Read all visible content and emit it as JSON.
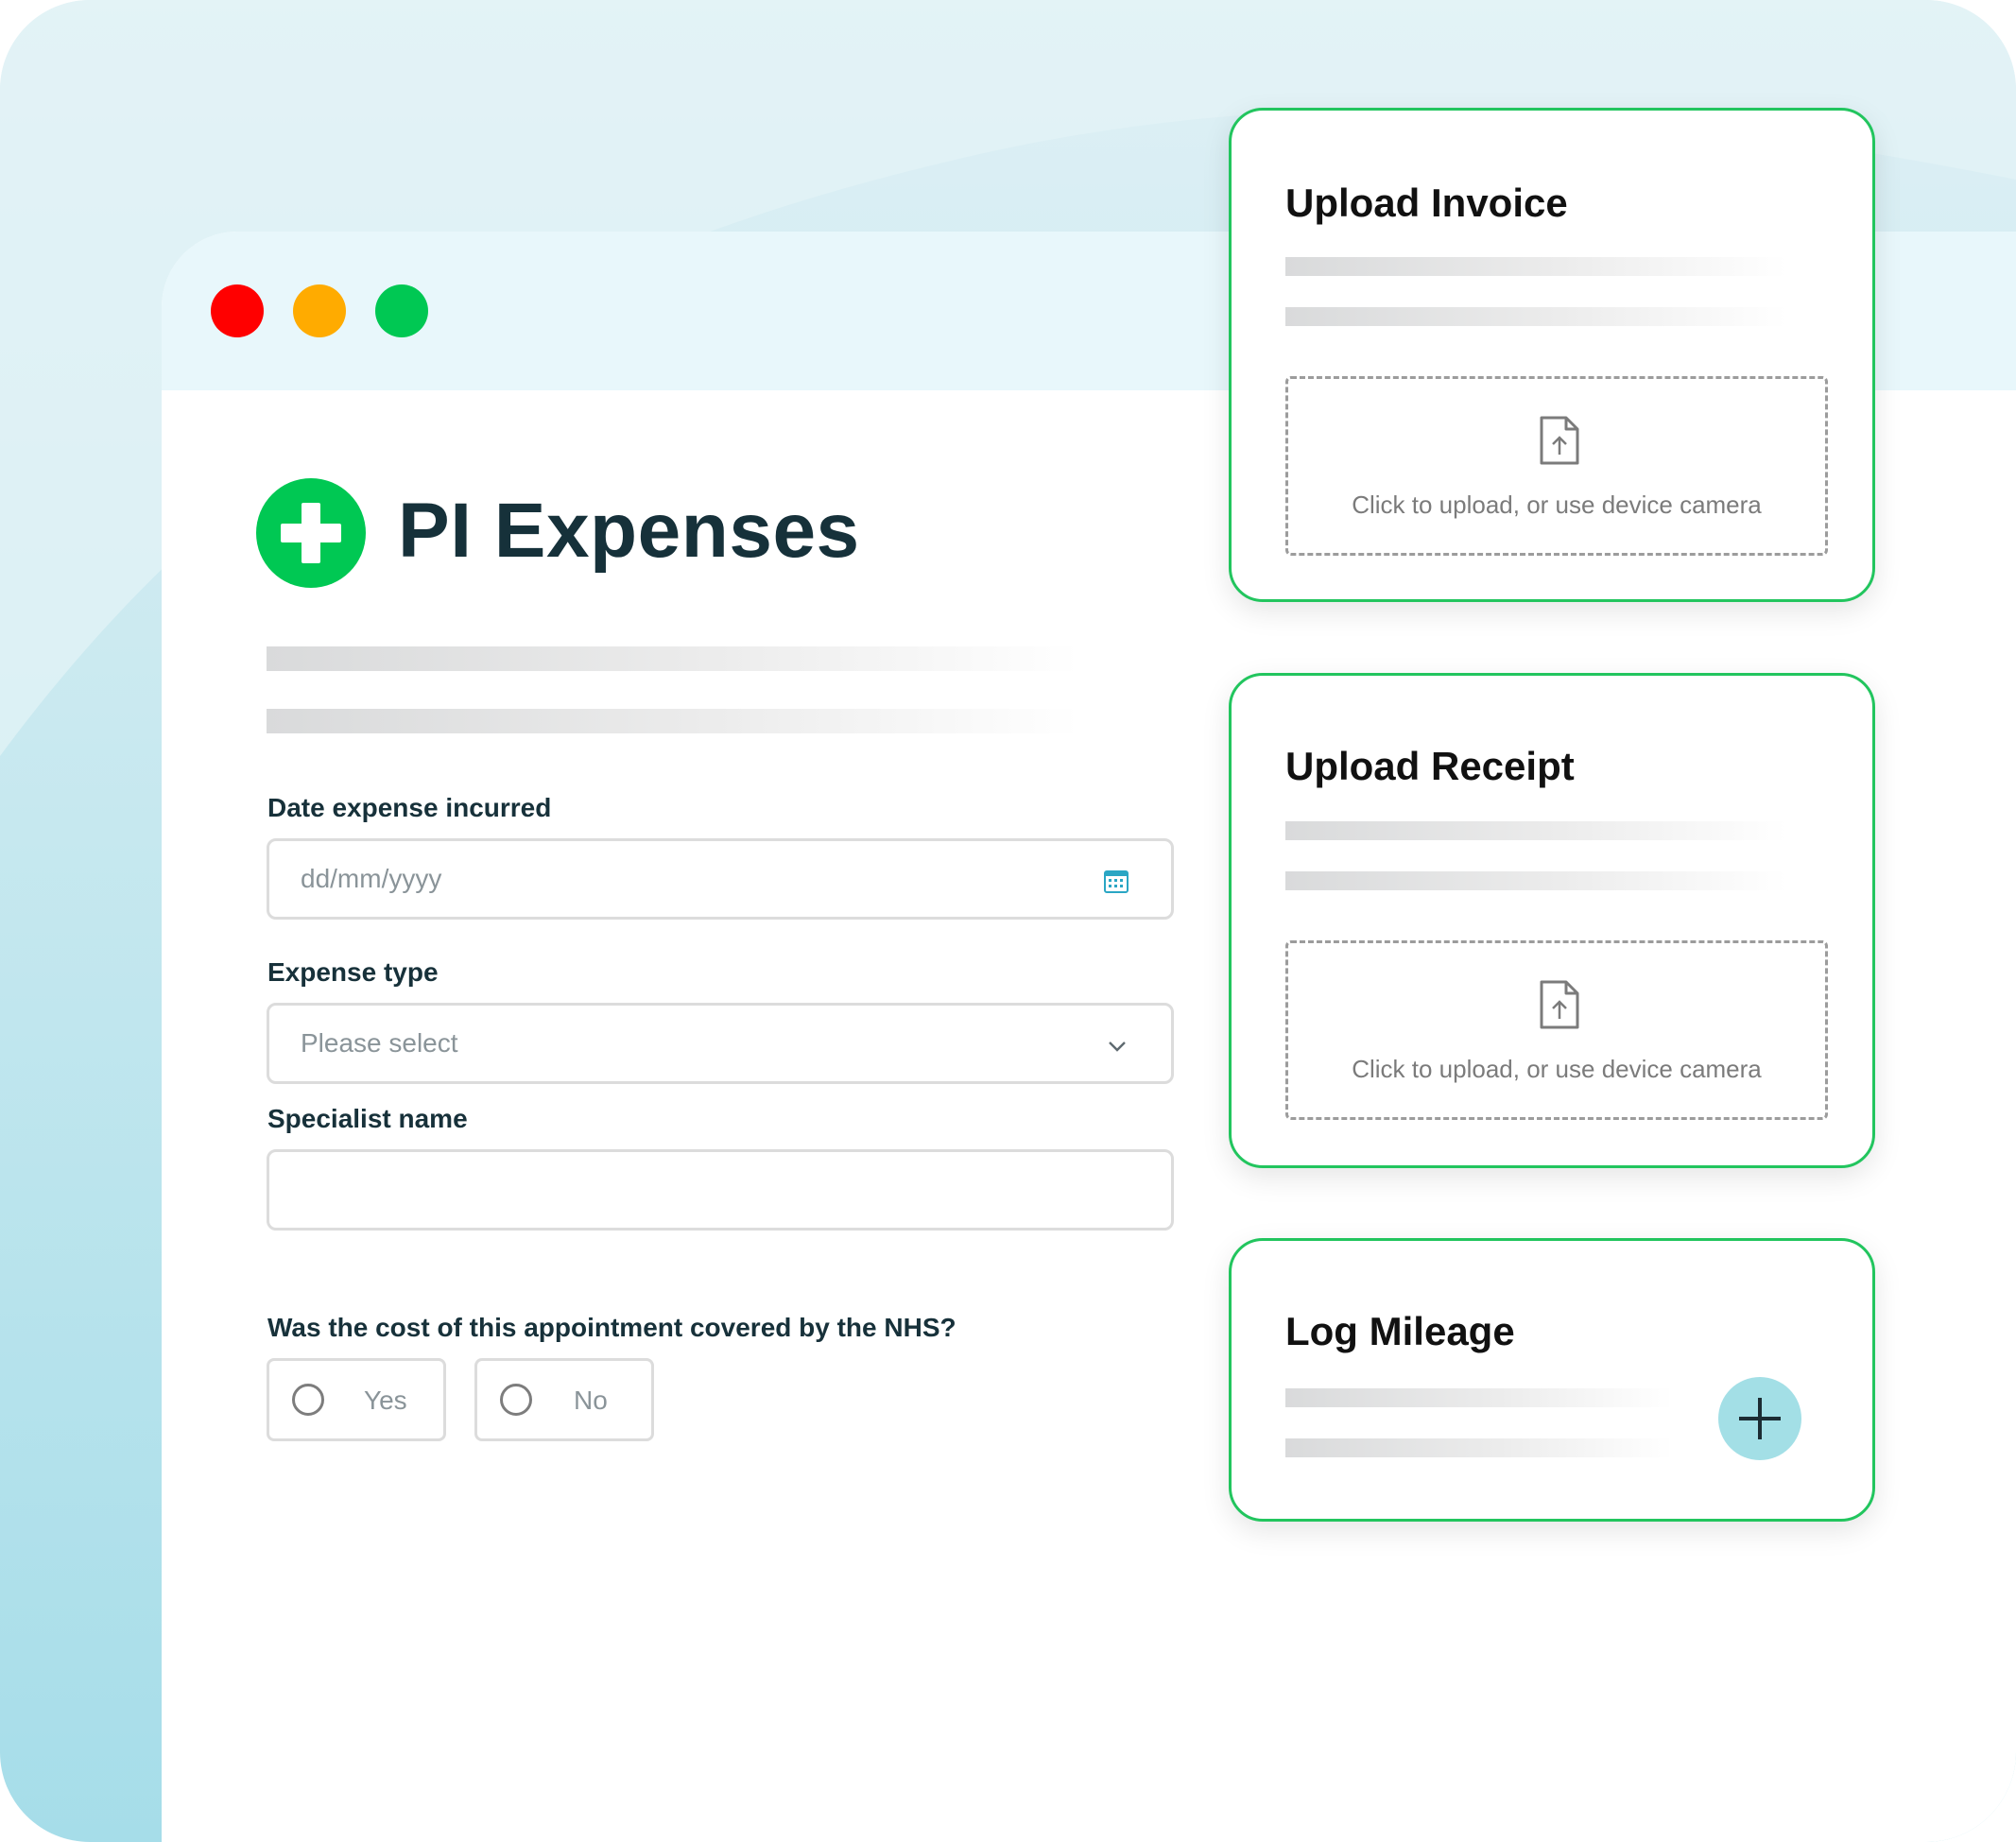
{
  "app": {
    "title": "PI Expenses",
    "brand_color": "#00c853",
    "accent_border_color": "#22c55e",
    "window_controls": [
      "close-dot",
      "minimize-dot",
      "maximize-dot"
    ]
  },
  "form": {
    "date_label": "Date expense incurred",
    "date_placeholder": "dd/mm/yyyy",
    "expense_type_label": "Expense type",
    "expense_type_value": "Please select",
    "specialist_label": "Specialist name",
    "specialist_value": "",
    "nhs_question": "Was the cost of this appointment covered by the NHS?",
    "nhs_options": [
      {
        "label": "Yes",
        "selected": false
      },
      {
        "label": "No",
        "selected": false
      }
    ]
  },
  "cards": {
    "invoice": {
      "title": "Upload Invoice",
      "upload_text": "Click to upload, or use device camera"
    },
    "receipt": {
      "title": "Upload Receipt",
      "upload_text": "Click to upload, or use device camera"
    },
    "mileage": {
      "title": "Log Mileage",
      "icon": "plus-icon"
    }
  }
}
